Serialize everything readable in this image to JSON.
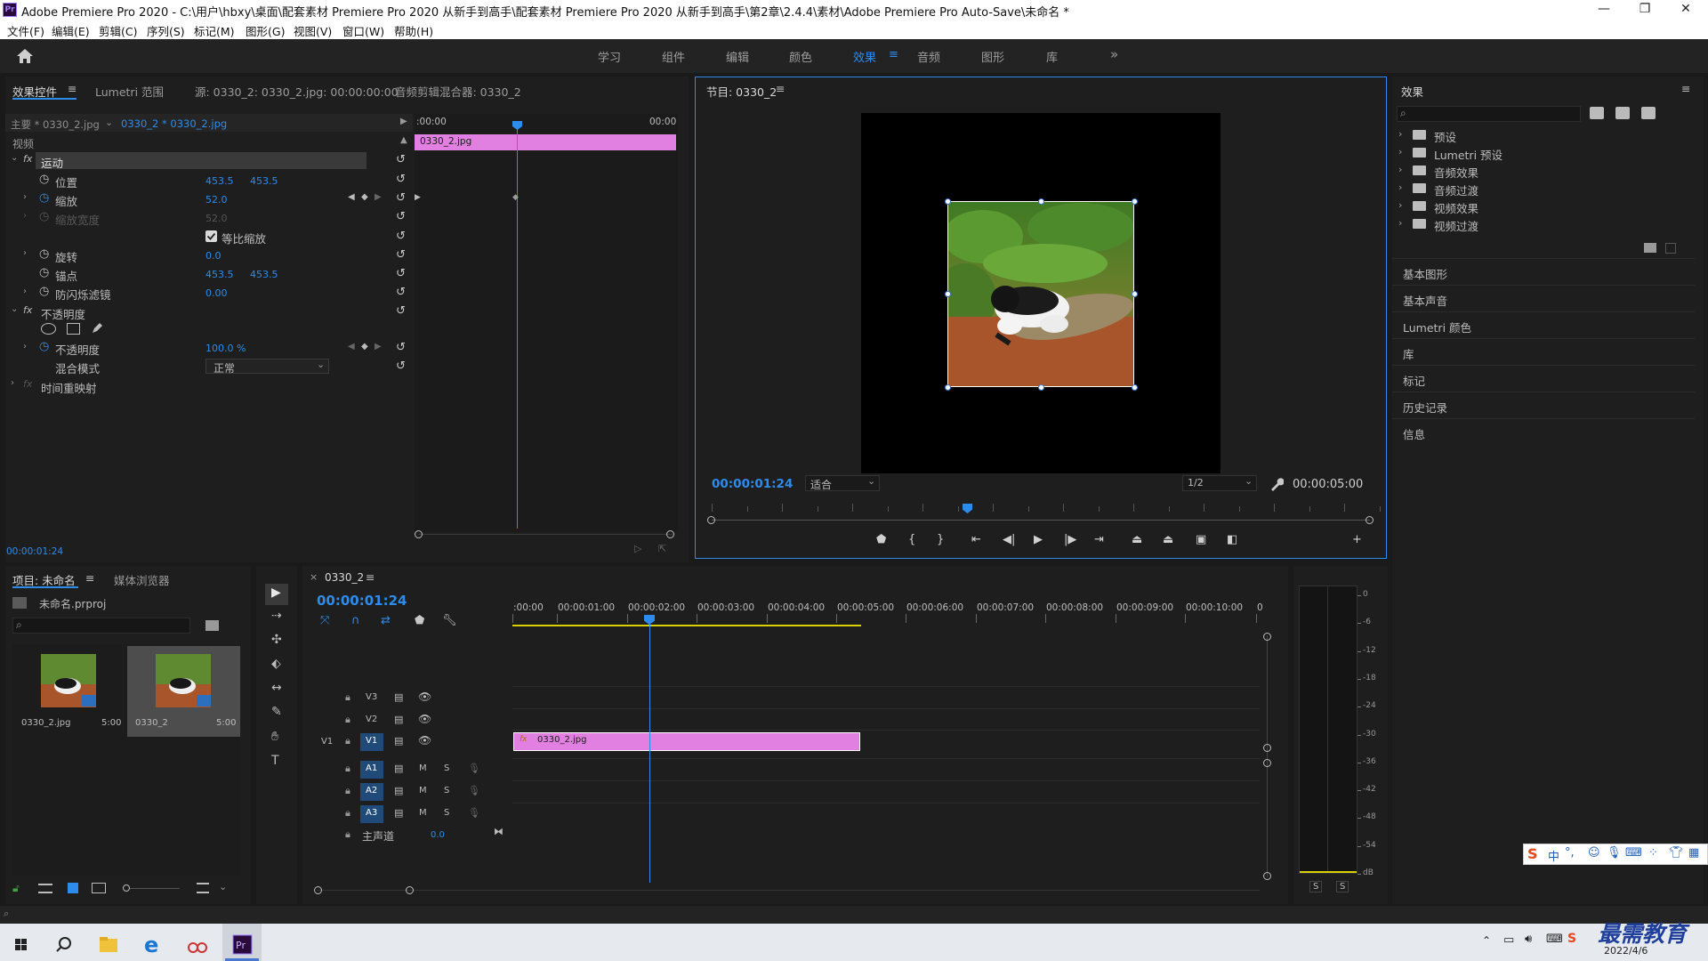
{
  "window": {
    "title": "Adobe Premiere Pro 2020 - C:\\用户\\hbxy\\桌面\\配套素材 Premiere Pro 2020 从新手到高手\\配套素材 Premiere Pro 2020 从新手到高手\\第2章\\2.4.4\\素材\\Adobe Premiere Pro Auto-Save\\未命名 *",
    "minimize": "—",
    "restore": "❐",
    "close": "✕"
  },
  "menu": [
    "文件(F)",
    "编辑(E)",
    "剪辑(C)",
    "序列(S)",
    "标记(M)",
    "图形(G)",
    "视图(V)",
    "窗口(W)",
    "帮助(H)"
  ],
  "workspaces": [
    "学习",
    "组件",
    "编辑",
    "颜色",
    "效果",
    "音频",
    "图形",
    "库"
  ],
  "workspace_active": "效果",
  "workspace_more": "»",
  "effect_controls": {
    "tabs": [
      "效果控件",
      "Lumetri 范围",
      "源: 0330_2: 0330_2.jpg: 00:00:00:00",
      "音频剪辑混合器: 0330_2"
    ],
    "master": "主要 * 0330_2.jpg",
    "clip": "0330_2 * 0330_2.jpg",
    "ruler_start": ":00:00",
    "ruler_end": "00:00",
    "clip_name": "0330_2.jpg",
    "video_label": "视频",
    "motion": "运动",
    "position": {
      "label": "位置",
      "x": "453.5",
      "y": "453.5"
    },
    "scale": {
      "label": "缩放",
      "value": "52.0"
    },
    "scale_width": {
      "label": "缩放宽度",
      "value": "52.0"
    },
    "uniform": "等比缩放",
    "rotation": {
      "label": "旋转",
      "value": "0.0"
    },
    "anchor": {
      "label": "锚点",
      "x": "453.5",
      "y": "453.5"
    },
    "flicker": {
      "label": "防闪烁滤镜",
      "value": "0.00"
    },
    "opacity_group": "不透明度",
    "opacity": {
      "label": "不透明度",
      "value": "100.0 %"
    },
    "blend": {
      "label": "混合模式",
      "value": "正常"
    },
    "time_remap": "时间重映射",
    "timecode": "00:00:01:24"
  },
  "program": {
    "title": "节目: 0330_2",
    "timecode": "00:00:01:24",
    "fit": "适合",
    "quality": "1/2",
    "duration": "00:00:05:00"
  },
  "effects": {
    "title": "效果",
    "folders": [
      "预设",
      "Lumetri 预设",
      "音频效果",
      "音频过渡",
      "视频效果",
      "视频过渡"
    ],
    "sections": [
      "基本图形",
      "基本声音",
      "Lumetri 颜色",
      "库",
      "标记",
      "历史记录",
      "信息"
    ]
  },
  "project": {
    "tabs": [
      "项目: 未命名",
      "媒体浏览器"
    ],
    "file": "未命名.prproj",
    "items": [
      {
        "name": "0330_2.jpg",
        "dur": "5:00"
      },
      {
        "name": "0330_2",
        "dur": "5:00"
      }
    ]
  },
  "timeline": {
    "tab": "0330_2",
    "timecode": "00:00:01:24",
    "ticks": [
      ":00:00",
      "00:00:01:00",
      "00:00:02:00",
      "00:00:03:00",
      "00:00:04:00",
      "00:00:05:00",
      "00:00:06:00",
      "00:00:07:00",
      "00:00:08:00",
      "00:00:09:00",
      "00:00:10:00",
      "0"
    ],
    "video_tracks": [
      "V3",
      "V2",
      "V1"
    ],
    "audio_tracks": [
      "A1",
      "A2",
      "A3"
    ],
    "source_v": "V1",
    "mute": "M",
    "solo": "S",
    "master": {
      "label": "主声道",
      "value": "0.0"
    },
    "clip": "0330_2.jpg"
  },
  "meter": {
    "scale": [
      "0",
      "-6",
      "-12",
      "-18",
      "-24",
      "-30",
      "-36",
      "-42",
      "-48",
      "-54",
      "dB"
    ],
    "solo": [
      "S",
      "S"
    ]
  },
  "taskbar": {
    "date": "2022/4/6",
    "watermark": "最需教育",
    "ime": "中"
  }
}
